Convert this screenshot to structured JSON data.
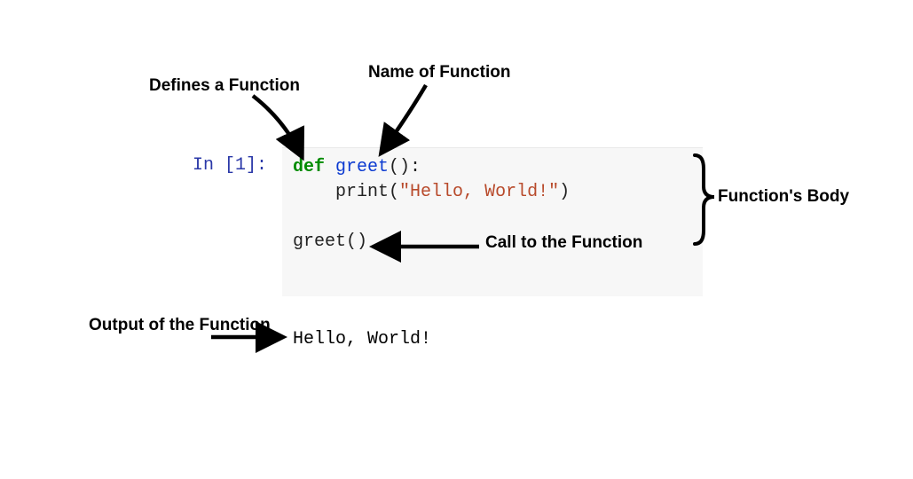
{
  "annotations": {
    "defines": "Defines a Function",
    "name": "Name of Function",
    "body": "Function's Body",
    "callLabel": "Call to\nthe Function",
    "outputLabel": "Output of the\nFunction"
  },
  "cell": {
    "prompt": "In [1]:",
    "code": {
      "kw_def": "def",
      "fname": "greet",
      "sig_close": "():",
      "print_call": "print",
      "print_open": "(",
      "string": "\"Hello, World!\"",
      "print_close": ")",
      "call_expr": "greet()"
    },
    "output": "Hello, World!"
  }
}
